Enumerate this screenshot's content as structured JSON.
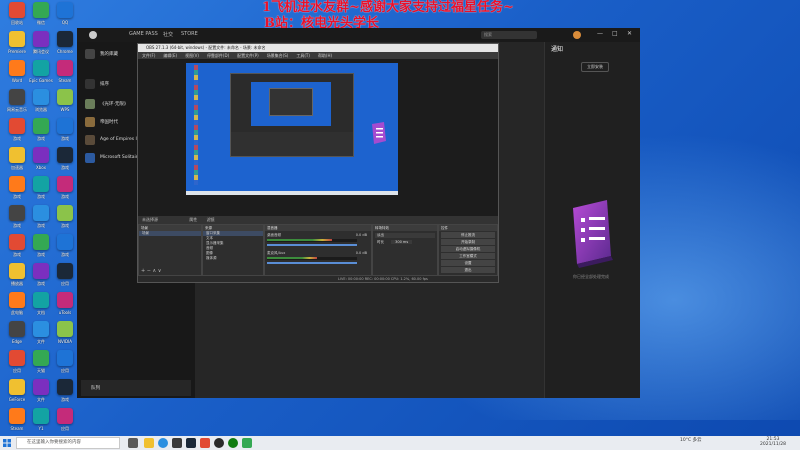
{
  "overlay": {
    "line1": "1飞机进水友群~感谢大家支持过福星任务~",
    "line2": "B站：核电光头学长"
  },
  "desktop_icons": [
    "回收站",
    "微信",
    "QQ",
    "Premiere",
    "腾讯会议",
    "Chrome",
    "Word",
    "Epic Games",
    "Steam",
    "网易云音乐",
    "浏览器",
    "WPS",
    "游戏",
    "游戏",
    "游戏",
    "加速器",
    "Xbox",
    "游戏",
    "游戏",
    "游戏",
    "游戏",
    "游戏",
    "游戏",
    "游戏",
    "游戏",
    "游戏",
    "游戏",
    "播放器",
    "游戏",
    "应用",
    "此电脑",
    "文档",
    "uTools",
    "Edge",
    "文件",
    "NVIDIA",
    "应用",
    "天猫",
    "应用",
    "GeForce",
    "文件",
    "游戏",
    "Steam",
    "Y1",
    "应用"
  ],
  "xbox": {
    "nav": [
      "GAME PASS",
      "社交",
      "STORE"
    ],
    "search_placeholder": "搜索",
    "manage_label": "我的库藏",
    "filter_label": "排序",
    "games": [
      "《光环·无限》",
      "帝国时代",
      "Age of Empires IV",
      "Microsoft Solitaire"
    ],
    "downloads_label": "队列",
    "notice_title": "通知",
    "notice_button": "立即安装",
    "notice_caption": "你已经全部处理完成",
    "controls": [
      "—",
      "□",
      "✕"
    ]
  },
  "obs": {
    "title": "OBS 27.1.3 (64-bit, windows) - 配置文件: 未命名 - 场景: 未命名",
    "menu": [
      "文件(F)",
      "编辑(E)",
      "视图(V)",
      "停靠部件(D)",
      "配置文件(P)",
      "场景集合(S)",
      "工具(T)",
      "帮助(H)"
    ],
    "status_label": "未选择源",
    "props_button": "属性",
    "filters_button": "滤镜",
    "scenes_header": "场景",
    "scene_item": "场景",
    "sources_header": "来源",
    "sources": [
      "窗口采集",
      "文本",
      "显示器采集",
      "音频",
      "图像",
      "媒体源"
    ],
    "mixer_header": "混音器",
    "mixer_tracks": [
      {
        "name": "桌面音频",
        "db": "0.0 dB",
        "level": 0.72
      },
      {
        "name": "麦克风/Aux",
        "db": "0.0 dB",
        "level": 0.55
      }
    ],
    "transitions_header": "转场特效",
    "transition_name": "淡出",
    "duration_label": "时长",
    "duration_value": "300 ms",
    "controls_header": "控件",
    "controls": [
      "停止推流",
      "开始录制",
      "启动虚拟摄像机",
      "工作室模式",
      "设置",
      "退出"
    ],
    "footer": "LIVE: 00:00:00  REC: 00:00:00  CPU: 1.2%, 60.00 fps"
  },
  "taskbar": {
    "search_placeholder": "在这里输入你要搜索的内容",
    "tray_temp": "10°C 多云",
    "tray_time": "21:53",
    "tray_date": "2021/11/28"
  },
  "colors": {
    "xbox_bg": "#1f1f1f",
    "overlay_red": "#e8102a",
    "desktop_blue": "#1a5fc8"
  }
}
